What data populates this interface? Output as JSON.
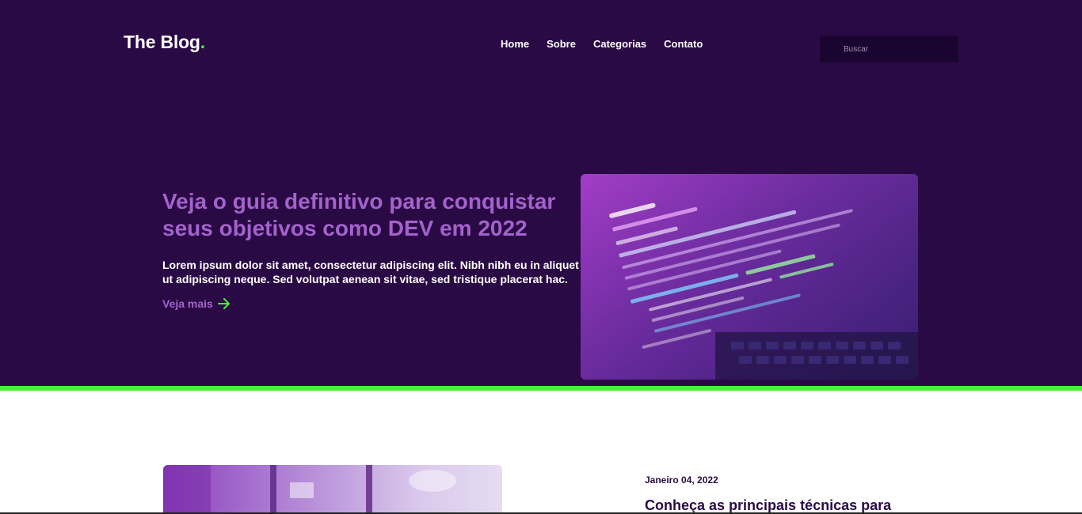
{
  "header": {
    "logo_text": "The Blog",
    "logo_dot": ".",
    "nav": [
      {
        "label": "Home"
      },
      {
        "label": "Sobre"
      },
      {
        "label": "Categorias"
      },
      {
        "label": "Contato"
      }
    ],
    "search": {
      "placeholder": "Buscar",
      "value": ""
    }
  },
  "hero": {
    "title": "Veja o guia definitivo para conquistar seus objetivos como DEV em 2022",
    "description": "Lorem ipsum dolor sit amet, consectetur adipiscing elit. Nibh nibh eu in aliquet ut adipiscing neque. Sed volutpat aenean sit vitae, sed tristique placerat hac.",
    "link_label": "Veja mais",
    "link_icon": "arrow-right-icon",
    "image": "code-on-laptop-screen"
  },
  "post": {
    "date": "Janeiro 04, 2022",
    "title": "Conheça as principais técnicas para",
    "image": "office-interior-purple"
  },
  "colors": {
    "background": "#2a0a45",
    "accent_purple": "#a462cc",
    "accent_green": "#4cf03c",
    "text_light": "#ffffff",
    "text_dark": "#2a0a45"
  }
}
